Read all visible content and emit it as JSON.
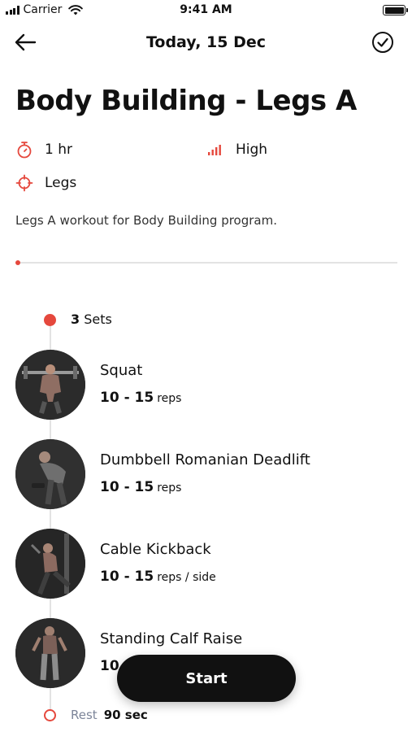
{
  "status_bar": {
    "carrier": "Carrier",
    "time": "9:41 AM"
  },
  "nav": {
    "title": "Today, 15 Dec",
    "back_icon": "arrow-left-icon",
    "done_icon": "check-circle-icon"
  },
  "workout": {
    "title": "Body Building - Legs A",
    "duration": "1 hr",
    "intensity": "High",
    "target": "Legs",
    "description": "Legs A workout for Body Building program."
  },
  "accent_color": "#e5483d",
  "sets": {
    "count": "3",
    "label": "Sets"
  },
  "exercises": [
    {
      "name": "Squat",
      "reps": "10 - 15",
      "unit": "reps"
    },
    {
      "name": "Dumbbell Romanian Deadlift",
      "reps": "10 - 15",
      "unit": "reps"
    },
    {
      "name": "Cable Kickback",
      "reps": "10 - 15",
      "unit": "reps / side"
    },
    {
      "name": "Standing Calf Raise",
      "reps": "10",
      "unit": ""
    }
  ],
  "rest": {
    "label": "Rest",
    "value": "90 sec"
  },
  "start_button": {
    "label": "Start"
  }
}
